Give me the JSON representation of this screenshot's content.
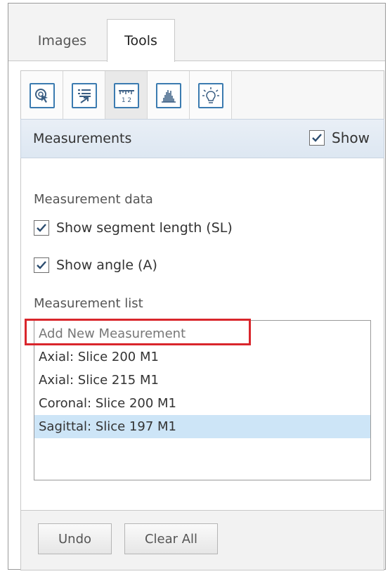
{
  "tabs": [
    {
      "label": "Images",
      "active": false
    },
    {
      "label": "Tools",
      "active": true
    }
  ],
  "toolbar": {
    "tools": [
      {
        "icon": "pointer-select-icon",
        "active": false
      },
      {
        "icon": "list-export-icon",
        "active": false
      },
      {
        "icon": "ruler-measure-icon",
        "active": true,
        "icon_text": "1 2"
      },
      {
        "icon": "histogram-icon",
        "active": false
      },
      {
        "icon": "lightbulb-icon",
        "active": false
      }
    ]
  },
  "section": {
    "title": "Measurements",
    "show_label": "Show",
    "show_checked": true
  },
  "measurement_data": {
    "heading": "Measurement data",
    "options": [
      {
        "label": "Show segment length (SL)",
        "checked": true
      },
      {
        "label": "Show angle (A)",
        "checked": true
      }
    ]
  },
  "measurement_list": {
    "heading": "Measurement list",
    "placeholder": "Add New Measurement",
    "items": [
      {
        "label": "Axial: Slice 200 M1",
        "selected": false
      },
      {
        "label": "Axial: Slice 215 M1",
        "selected": false
      },
      {
        "label": "Coronal: Slice 200 M1",
        "selected": false
      },
      {
        "label": "Sagittal: Slice 197 M1",
        "selected": true
      }
    ]
  },
  "footer": {
    "undo_label": "Undo",
    "clear_all_label": "Clear All"
  },
  "colors": {
    "accent": "#3b7bb0",
    "selection": "#cde5f7",
    "highlight_box": "#d9262c"
  }
}
